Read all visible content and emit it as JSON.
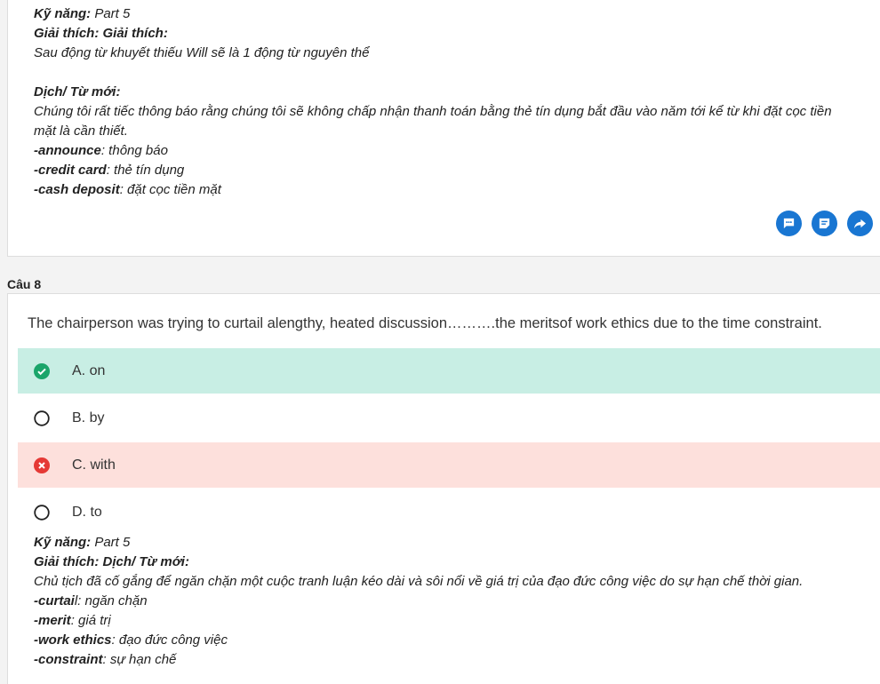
{
  "prev_explanation": {
    "skill_label": "Kỹ năng:",
    "skill_value": " Part 5",
    "expl_label": "Giải thích: Giải thích:",
    "expl_text": "Sau động từ khuyết thiếu Will sẽ là 1 động từ nguyên thể",
    "trans_label": "Dịch/ Từ mới:",
    "trans_line1": "Chúng tôi rất tiếc thông báo rằng chúng tôi sẽ không chấp nhận thanh toán bằng thẻ tín dụng bắt đầu vào năm tới kể từ khi đặt cọc tiền",
    "trans_line2": "mặt là cần thiết.",
    "vocab": [
      {
        "word": "-announce",
        "meaning": ": thông báo"
      },
      {
        "word": "-credit card",
        "meaning": ": thẻ tín dụng"
      },
      {
        "word": "-cash deposit",
        "meaning": ": đặt cọc tiền mặt"
      }
    ]
  },
  "actions": {
    "comment_icon": "comment-icon",
    "note_icon": "note-icon",
    "share_icon": "share-icon",
    "color": "#1976d2"
  },
  "question": {
    "label": "Câu 8",
    "text": "The chairperson was trying to curtail alengthy, heated discussion……….the meritsof work ethics due to the time constraint.",
    "options": [
      {
        "label": "A. on",
        "state": "correct"
      },
      {
        "label": "B. by",
        "state": "unselected"
      },
      {
        "label": "C. with",
        "state": "wrong"
      },
      {
        "label": "D. to",
        "state": "unselected"
      }
    ]
  },
  "explanation": {
    "skill_label": "Kỹ năng:",
    "skill_value": " Part 5",
    "expl_label": "Giải thích: Dịch/ Từ mới:",
    "expl_text": "Chủ tịch đã cố gắng để ngăn chặn một cuộc tranh luận kéo dài và sôi nổi về giá trị của đạo đức công việc do sự hạn chế thời gian.",
    "vocab": [
      {
        "word": "-curtai",
        "meaning": "l: ngăn chặn"
      },
      {
        "word": "-merit",
        "meaning": ": giá trị"
      },
      {
        "word": "-work ethics",
        "meaning": ": đạo đức công việc"
      },
      {
        "word": "-constraint",
        "meaning": ": sự hạn chế"
      }
    ]
  },
  "colors": {
    "correct_bg": "#c8eee4",
    "correct_icon": "#1aa56a",
    "wrong_bg": "#fde0dc",
    "wrong_icon": "#e53935"
  }
}
